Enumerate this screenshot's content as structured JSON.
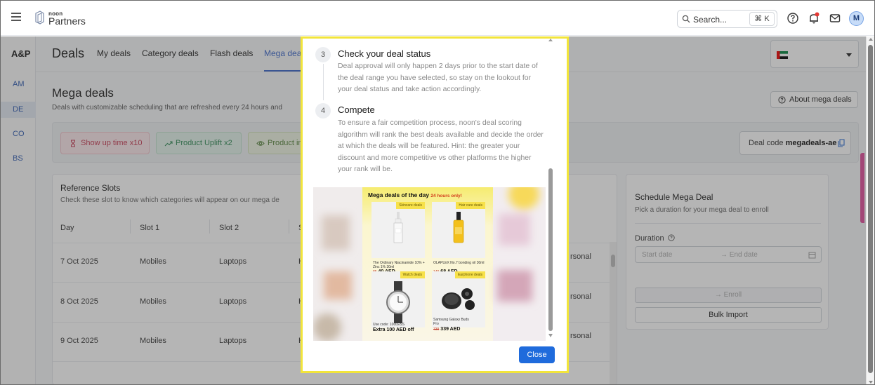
{
  "topbar": {
    "brand_small": "noon",
    "brand": "Partners",
    "search_placeholder": "Search...",
    "shortcut": "⌘ K",
    "avatar_initial": "M"
  },
  "sidebar": {
    "title": "A&P",
    "items": [
      {
        "label": "AM"
      },
      {
        "label": "DE"
      },
      {
        "label": "CO"
      },
      {
        "label": "BS"
      }
    ]
  },
  "deals": {
    "title": "Deals",
    "tabs": [
      {
        "label": "My deals"
      },
      {
        "label": "Category deals"
      },
      {
        "label": "Flash deals"
      },
      {
        "label": "Mega dea"
      }
    ]
  },
  "mega": {
    "title": "Mega deals",
    "subtitle": "Deals with customizable scheduling that are refreshed every 24 hours and",
    "about_button": "About mega deals",
    "pills": [
      {
        "label": "Show up time x10"
      },
      {
        "label": "Product Uplift x2"
      },
      {
        "label": "Product in"
      }
    ],
    "deal_code_label": "Deal code",
    "deal_code": "megadeals-ae"
  },
  "reference": {
    "title": "Reference Slots",
    "subtitle": "Check these slot to know which categories will appear on our mega de",
    "columns": [
      "Day",
      "Slot 1",
      "Slot 2",
      "S"
    ],
    "rows": [
      {
        "day": "7 Oct 2025",
        "slot1": "Mobiles",
        "slot2": "Laptops",
        "slot3": "H",
        "right": "rsonal"
      },
      {
        "day": "8 Oct 2025",
        "slot1": "Mobiles",
        "slot2": "Laptops",
        "slot3": "H",
        "right": "rsonal"
      },
      {
        "day": "9 Oct 2025",
        "slot1": "Mobiles",
        "slot2": "Laptops",
        "slot3": "H",
        "right": "rsonal"
      }
    ]
  },
  "schedule": {
    "title": "Schedule Mega Deal",
    "subtitle": "Pick a duration for your mega deal to enroll",
    "duration_label": "Duration",
    "start_placeholder": "Start date",
    "end_placeholder": "→ End date",
    "enroll_label": "→ Enroll",
    "bulk_label": "Bulk Import"
  },
  "modal": {
    "steps": [
      {
        "number": "3",
        "title": "Check your deal status",
        "desc": "Deal approval will only happen 2 days prior to the start date of the deal range you have selected, so stay on the lookout for your deal status and take action accordingly."
      },
      {
        "number": "4",
        "title": "Compete",
        "desc": "To ensure a fair competition process, noon's deal scoring algorithm will rank the best deals available and decide the order at which the deals will be featured. Hint: the greater your discount and more competitive vs other platforms the higher your rank will be."
      }
    ],
    "promo": {
      "title": "Mega deals of the day",
      "badge": "24 hours only!",
      "cards": [
        {
          "tag": "Skincare deals",
          "name": "The Ordinary Niacinamide 10% + Zinc 1% 30ml",
          "old": "85",
          "price": "40 AED"
        },
        {
          "tag": "Hair care deals",
          "name": "OLAPLEX No.7 bonding oil 30ml",
          "old": "140",
          "price": "68 AED"
        },
        {
          "tag": "Watch deals",
          "name": "Use code: 100LESS",
          "old": "",
          "price": "Extra 100 AED off"
        },
        {
          "tag": "Earphone deals",
          "name": "Samsung Galaxy Buds Pro",
          "old": "739",
          "price": "339 AED"
        }
      ]
    },
    "close_label": "Close"
  }
}
